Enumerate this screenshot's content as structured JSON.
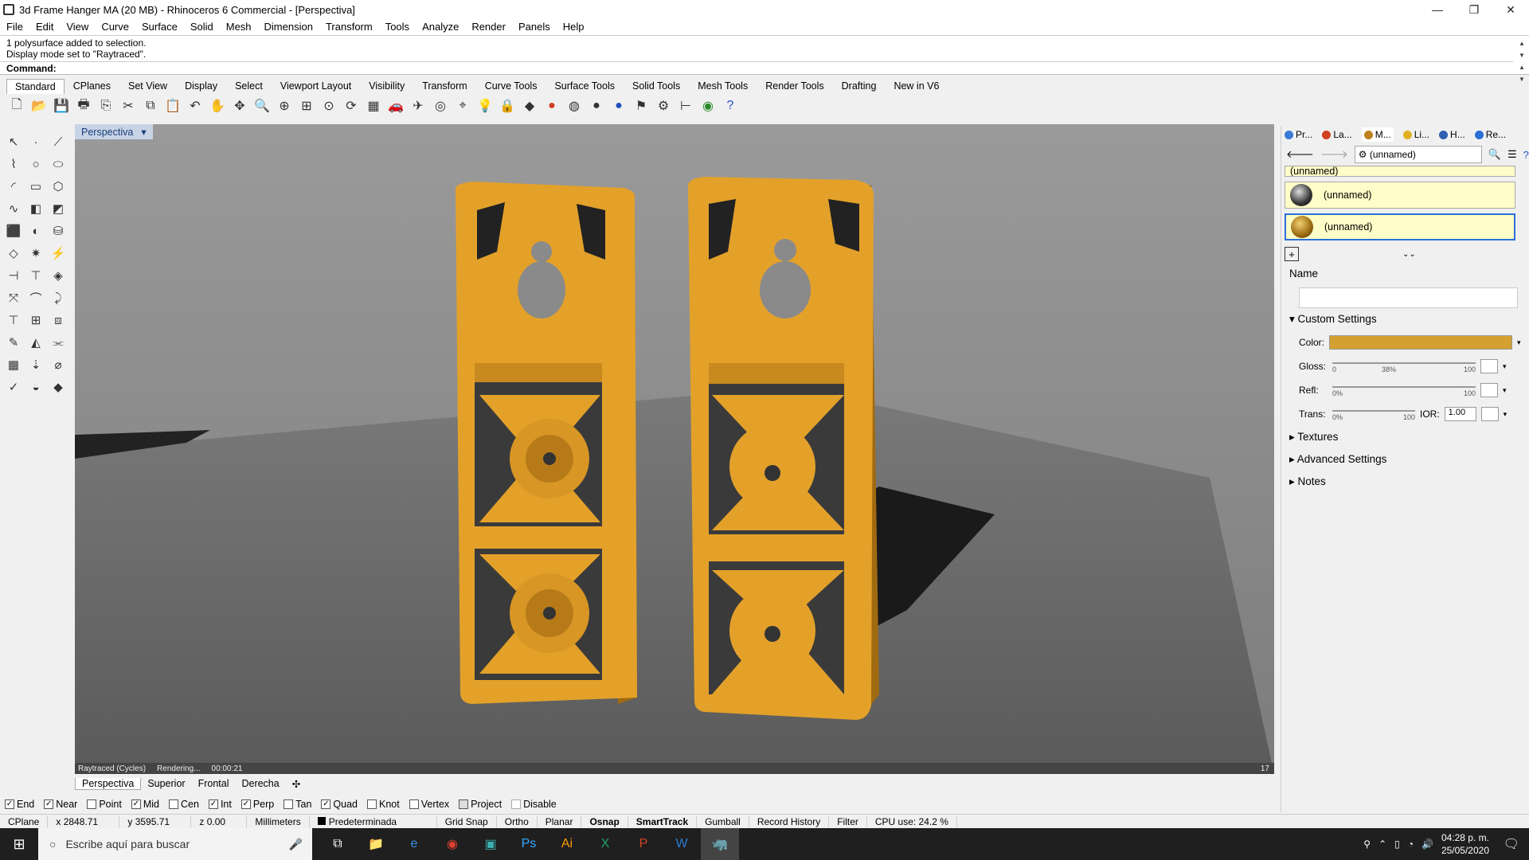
{
  "window": {
    "title": "3d Frame Hanger MA (20 MB) - Rhinoceros 6 Commercial - [Perspectiva]"
  },
  "menu": [
    "File",
    "Edit",
    "View",
    "Curve",
    "Surface",
    "Solid",
    "Mesh",
    "Dimension",
    "Transform",
    "Tools",
    "Analyze",
    "Render",
    "Panels",
    "Help"
  ],
  "history": {
    "line1": "1 polysurface added to selection.",
    "line2": "Display mode set to \"Raytraced\".",
    "command_label": "Command:"
  },
  "toolbar_tabs": [
    "Standard",
    "CPlanes",
    "Set View",
    "Display",
    "Select",
    "Viewport Layout",
    "Visibility",
    "Transform",
    "Curve Tools",
    "Surface Tools",
    "Solid Tools",
    "Mesh Tools",
    "Render Tools",
    "Drafting",
    "New in V6"
  ],
  "toolbar_icons": [
    "new-icon",
    "open-icon",
    "save-icon",
    "print-icon",
    "import-icon",
    "cut-icon",
    "copy-icon",
    "paste-icon",
    "undo-icon",
    "pan-icon",
    "move-icon",
    "zoom-icon",
    "zoom-window-icon",
    "zoom-extents-icon",
    "zoom-selected-icon",
    "rotate-view-icon",
    "viewport-grid-icon",
    "car-icon",
    "plane-icon",
    "target-icon",
    "snap-icon",
    "light-icon",
    "lock-icon",
    "material-icon",
    "color-wheel-icon",
    "sphere-icon",
    "render-sphere-icon",
    "blue-sphere-icon",
    "flag-icon",
    "gear-icon",
    "dimension-icon",
    "globe-icon",
    "help-icon"
  ],
  "viewport": {
    "name": "Perspectiva",
    "status_mode": "Raytraced (Cycles)",
    "status_rendering": "Rendering...",
    "status_time": "00:00:21",
    "corner_number": "17"
  },
  "viewport_tabs": [
    "Perspectiva",
    "Superior",
    "Frontal",
    "Derecha"
  ],
  "panel": {
    "tabs": [
      {
        "label": "Pr...",
        "color": "#3a7bd5"
      },
      {
        "label": "La...",
        "color": "#d04020"
      },
      {
        "label": "M...",
        "color": "#c08020"
      },
      {
        "label": "Li...",
        "color": "#e0b020"
      },
      {
        "label": "H...",
        "color": "#3060b0"
      },
      {
        "label": "Re...",
        "color": "#2a6fd6"
      }
    ],
    "current_material": "(unnamed)",
    "materials": [
      "(unnamed)",
      "(unnamed)",
      "(unnamed)"
    ],
    "name_label": "Name",
    "custom_settings": "Custom Settings",
    "color_label": "Color:",
    "color_value": "#d4a030",
    "gloss_label": "Gloss:",
    "gloss_min": "0",
    "gloss_max": "100",
    "gloss_value": "38%",
    "refl_label": "Refl:",
    "refl_min": "0%",
    "refl_max": "100",
    "trans_label": "Trans:",
    "trans_min": "0%",
    "trans_max": "100",
    "ior_label": "IOR:",
    "ior_value": "1.00",
    "textures": "Textures",
    "advanced": "Advanced Settings",
    "notes": "Notes"
  },
  "osnap": [
    {
      "label": "End",
      "checked": true
    },
    {
      "label": "Near",
      "checked": true
    },
    {
      "label": "Point",
      "checked": false
    },
    {
      "label": "Mid",
      "checked": true
    },
    {
      "label": "Cen",
      "checked": false
    },
    {
      "label": "Int",
      "checked": true
    },
    {
      "label": "Perp",
      "checked": true
    },
    {
      "label": "Tan",
      "checked": false
    },
    {
      "label": "Quad",
      "checked": true
    },
    {
      "label": "Knot",
      "checked": false
    },
    {
      "label": "Vertex",
      "checked": false
    },
    {
      "label": "Project",
      "checked": false
    },
    {
      "label": "Disable",
      "checked": false
    }
  ],
  "statusbar": {
    "cplane": "CPlane",
    "x": "x 2848.71",
    "y": "y 3595.71",
    "z": "z 0.00",
    "units": "Millimeters",
    "layer": "Predeterminada",
    "grid_snap": "Grid Snap",
    "ortho": "Ortho",
    "planar": "Planar",
    "osnap": "Osnap",
    "smarttrack": "SmartTrack",
    "gumball": "Gumball",
    "record_history": "Record History",
    "filter": "Filter",
    "cpu": "CPU use: 24.2 %"
  },
  "taskbar": {
    "search_placeholder": "Escribe aquí para buscar",
    "time": "04:28 p. m.",
    "date": "25/05/2020"
  },
  "colors": {
    "object": "#e3a12a",
    "viewport_bg": "#8a8a8a",
    "accent": "#2a6fd6"
  }
}
